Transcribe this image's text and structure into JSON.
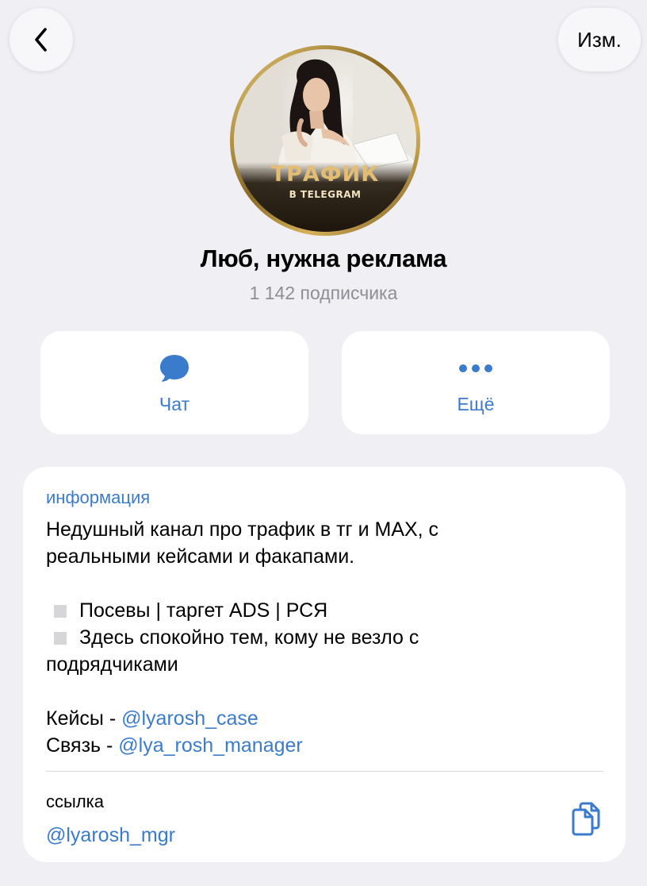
{
  "nav": {
    "edit_label": "Изм."
  },
  "profile": {
    "avatar_title": "ТРАФИК",
    "avatar_subtitle": "В TELEGRAM",
    "name": "Люб, нужна реклама",
    "subscribers": "1 142 подписчика"
  },
  "actions": {
    "chat_label": "Чат",
    "more_label": "Ещё"
  },
  "info": {
    "header": "информация",
    "description_line1": "Недушный канал про трафик в тг и MAX, с",
    "description_line2": "реальными кейсами и факапами.",
    "bullet1": "Посевы | таргет ADS | РСЯ",
    "bullet2_line1": "Здесь спокойно тем, кому не везло с",
    "bullet2_line2": "подрядчиками",
    "cases_label": "Кейсы - ",
    "cases_mention": "@lyarosh_case",
    "contact_label": "Связь - ",
    "contact_mention": "@lya_rosh_manager"
  },
  "link": {
    "label": "ссылка",
    "value": "@lyarosh_mgr"
  },
  "colors": {
    "accent": "#3a7bcc",
    "background": "#efeff4",
    "secondary_text": "#8e8e93",
    "avatar_gold": "#e2bd73"
  },
  "icons": {
    "back": "chevron-left-icon",
    "chat": "chat-bubble-icon",
    "more": "more-dots-icon",
    "copy": "copy-icon"
  }
}
